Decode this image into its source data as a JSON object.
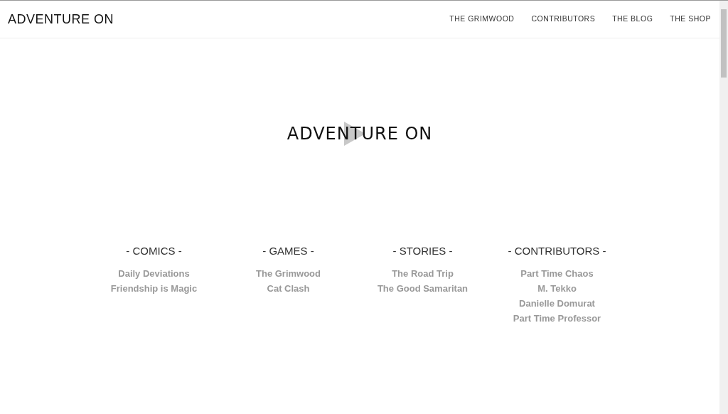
{
  "header": {
    "brand": "ADVENTURE ON",
    "nav": [
      {
        "label": "THE GRIMWOOD"
      },
      {
        "label": "CONTRIBUTORS"
      },
      {
        "label": "THE BLOG"
      },
      {
        "label": "THE SHOP"
      }
    ]
  },
  "hero": {
    "logo_text": "ADVENTURE ON"
  },
  "sections": [
    {
      "title": "- COMICS -",
      "links": [
        "Daily Deviations",
        "Friendship is Magic"
      ]
    },
    {
      "title": "- GAMES -",
      "links": [
        "The Grimwood",
        "Cat Clash"
      ]
    },
    {
      "title": "- STORIES -",
      "links": [
        "The Road Trip",
        "The Good Samaritan"
      ]
    },
    {
      "title": "- CONTRIBUTORS -",
      "links": [
        "Part Time Chaos",
        "M. Tekko",
        "Danielle Domurat",
        "Part Time Professor"
      ]
    }
  ]
}
